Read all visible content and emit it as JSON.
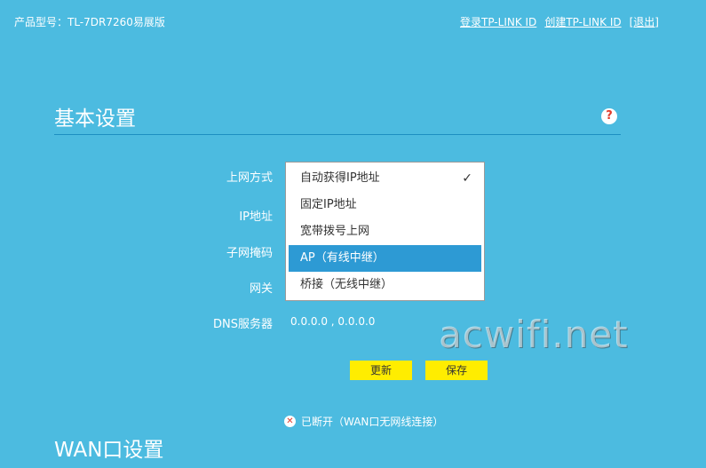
{
  "header": {
    "model_label": "产品型号：TL-7DR7260易展版",
    "links": [
      "登录TP-LINK ID",
      "创建TP-LINK ID",
      "[退出]"
    ]
  },
  "basic_settings": {
    "title": "基本设置",
    "help_icon": "help-icon",
    "labels": {
      "connection_type": "上网方式",
      "ip": "IP地址",
      "subnet": "子网掩码",
      "gateway": "网关",
      "dns": "DNS服务器"
    },
    "dns_value": "0.0.0.0 , 0.0.0.0",
    "dropdown": {
      "options": [
        "自动获得IP地址",
        "固定IP地址",
        "宽带拨号上网",
        "AP（有线中继）",
        "桥接（无线中继）"
      ],
      "checked_index": 0,
      "highlighted_index": 3,
      "check_icon": "checkmark-icon"
    },
    "buttons": {
      "refresh": "更新",
      "save": "保存"
    },
    "status": "已断开（WAN口无网线连接）",
    "status_icon": "x-circle-icon"
  },
  "wan_section": {
    "title": "WAN口设置"
  },
  "watermark": "acwifi.net",
  "colors": {
    "background": "#4cbbe0",
    "button": "#ffed00",
    "highlight": "#2d9ad4",
    "help_icon": "#e03b2b"
  }
}
